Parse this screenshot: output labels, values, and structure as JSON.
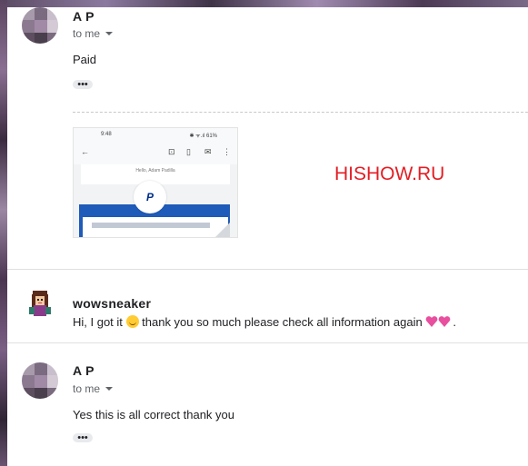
{
  "watermark": "HISHOW.RU",
  "messages": [
    {
      "sender": "A P",
      "recipient_label": "to me",
      "body": "Paid",
      "more_label": "•••",
      "attachment": {
        "status_time": "9:48",
        "status_right": "✱ ᯤ.ıl 61%",
        "card_text": "Hello, Adam Padilla",
        "logo_text": "P"
      }
    },
    {
      "sender": "wowsneaker",
      "body_before_emoji": "Hi, I got it ",
      "body_after_emoji": " thank you so much please check all information again ",
      "body_end": "."
    },
    {
      "sender": "A P",
      "recipient_label": "to me",
      "body": "Yes this is all correct thank you",
      "more_label": "•••"
    }
  ],
  "icons": {
    "avatar": "blurred-avatar",
    "sender2_avatar": "cartoon-avatar",
    "smile": "smiling-face-emoji",
    "hearts": "two-hearts-emoji"
  },
  "colors": {
    "watermark": "#e31e24",
    "paypal_blue": "#1f5bb8"
  }
}
